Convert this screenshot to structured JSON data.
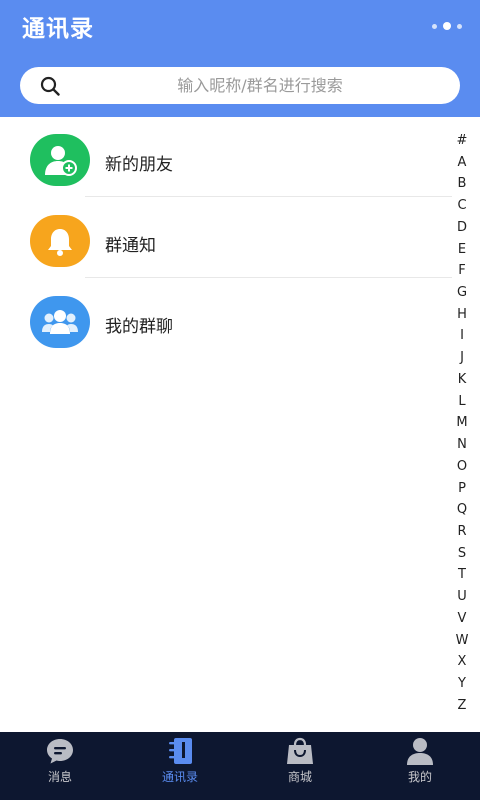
{
  "header": {
    "title": "通讯录",
    "more_icon": "more-dots-icon"
  },
  "search": {
    "placeholder": "输入昵称/群名进行搜索",
    "icon": "search-icon"
  },
  "list": {
    "items": [
      {
        "label": "新的朋友",
        "icon": "add-friend-icon",
        "color": "#1fbf5f"
      },
      {
        "label": "群通知",
        "icon": "bell-icon",
        "color": "#f7a51d"
      },
      {
        "label": "我的群聊",
        "icon": "group-icon",
        "color": "#3f97ee"
      }
    ]
  },
  "index": [
    "#",
    "A",
    "B",
    "C",
    "D",
    "E",
    "F",
    "G",
    "H",
    "I",
    "J",
    "K",
    "L",
    "M",
    "N",
    "O",
    "P",
    "Q",
    "R",
    "S",
    "T",
    "U",
    "V",
    "W",
    "X",
    "Y",
    "Z"
  ],
  "tabbar": {
    "active": "通讯录",
    "active_color": "#5a8cf0",
    "tabs": [
      {
        "label": "消息",
        "icon": "message-icon"
      },
      {
        "label": "通讯录",
        "icon": "contacts-icon"
      },
      {
        "label": "商城",
        "icon": "shopping-bag-icon"
      },
      {
        "label": "我的",
        "icon": "profile-icon"
      }
    ]
  },
  "colors": {
    "header_bg": "#5a8cf0",
    "tabbar_bg": "#0d1730"
  }
}
